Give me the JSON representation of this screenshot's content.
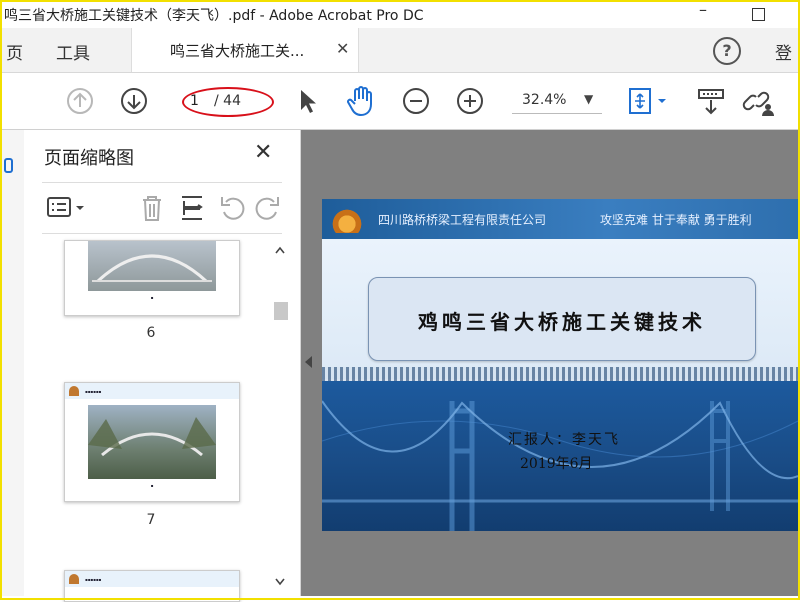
{
  "window": {
    "title": "鸣三省大桥施工关键技术（李天飞）.pdf - Adobe Acrobat Pro DC"
  },
  "tabbar": {
    "home": "页",
    "tools": "工具",
    "document_tab": "鸣三省大桥施工关...",
    "login": "登"
  },
  "toolbar": {
    "page_current": "1",
    "page_total": "/ 44",
    "zoom": "32.4%"
  },
  "thumbnails": {
    "title": "页面缩略图",
    "pages": [
      {
        "number": "6"
      },
      {
        "number": "7"
      }
    ]
  },
  "slide": {
    "company": "四川路桥桥梁工程有限责任公司",
    "slogan": "攻坚克难  甘于奉献  勇于胜利",
    "title": "鸡鸣三省大桥施工关键技术",
    "presenter": "汇报人：李天飞",
    "date": "2019年6月"
  },
  "colors": {
    "annotation_circle": "#d8101a",
    "accent_blue": "#1e5d9a",
    "frame": "#f2e000"
  }
}
